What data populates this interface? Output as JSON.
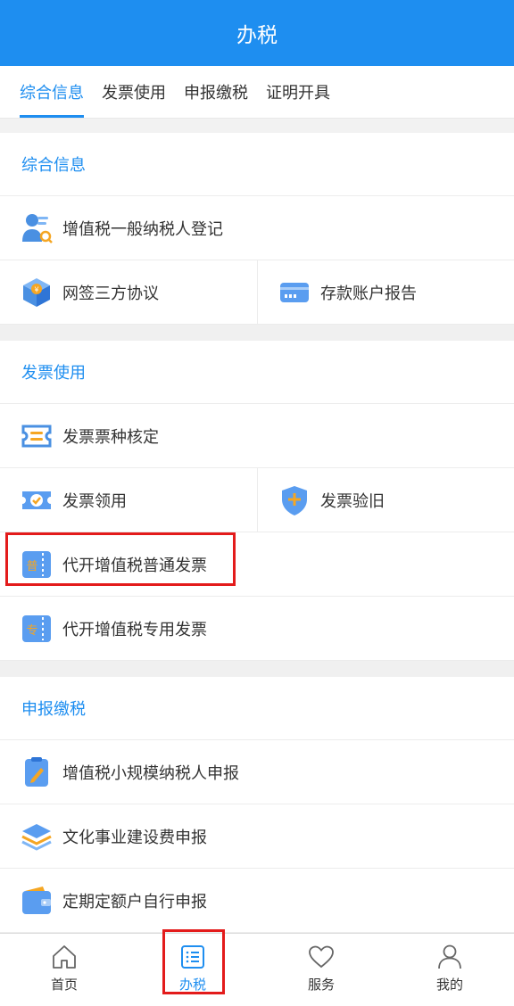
{
  "header": {
    "title": "办税"
  },
  "tabs": [
    {
      "label": "综合信息",
      "active": true
    },
    {
      "label": "发票使用",
      "active": false
    },
    {
      "label": "申报缴税",
      "active": false
    },
    {
      "label": "证明开具",
      "active": false
    }
  ],
  "sections": {
    "general": {
      "title": "综合信息",
      "item_vat_register": "增值税一般纳税人登记",
      "item_tripartite": "网签三方协议",
      "item_deposit_report": "存款账户报告"
    },
    "invoice": {
      "title": "发票使用",
      "item_type_check": "发票票种核定",
      "item_receive": "发票领用",
      "item_verify": "发票验旧",
      "item_general_invoice": "代开增值税普通发票",
      "item_special_invoice": "代开增值税专用发票"
    },
    "declare": {
      "title": "申报缴税",
      "item_small_scale": "增值税小规模纳税人申报",
      "item_culture_fee": "文化事业建设费申报",
      "item_fixed_quota": "定期定额户自行申报"
    }
  },
  "icon_glyphs": {
    "yuan": "¥",
    "pu": "普",
    "zhuan": "专"
  },
  "bottom_nav": {
    "home": "首页",
    "tax": "办税",
    "service": "服务",
    "mine": "我的"
  },
  "colors": {
    "accent": "#1e8ef0",
    "highlight": "#e31b1b"
  }
}
